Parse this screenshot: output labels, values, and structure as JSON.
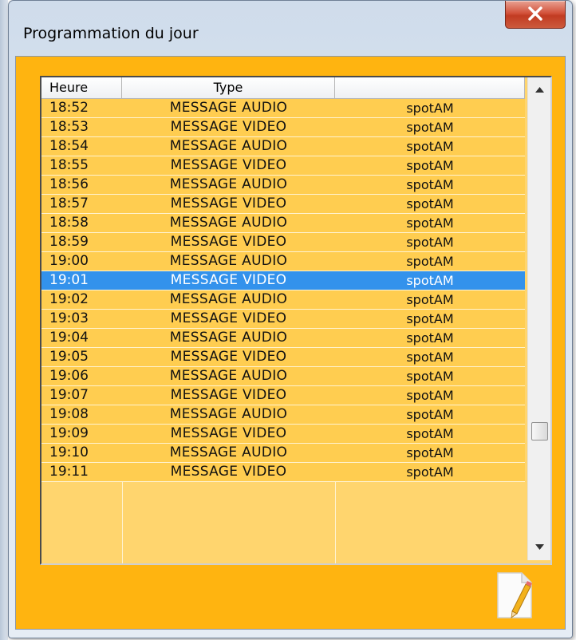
{
  "window": {
    "title": "Programmation du jour"
  },
  "table": {
    "columns": [
      "Heure",
      "Type",
      ""
    ],
    "rows": [
      {
        "heure": "18:52",
        "type": "MESSAGE AUDIO",
        "source": "spotAM"
      },
      {
        "heure": "18:53",
        "type": "MESSAGE VIDEO",
        "source": "spotAM"
      },
      {
        "heure": "18:54",
        "type": "MESSAGE AUDIO",
        "source": "spotAM"
      },
      {
        "heure": "18:55",
        "type": "MESSAGE VIDEO",
        "source": "spotAM"
      },
      {
        "heure": "18:56",
        "type": "MESSAGE AUDIO",
        "source": "spotAM"
      },
      {
        "heure": "18:57",
        "type": "MESSAGE VIDEO",
        "source": "spotAM"
      },
      {
        "heure": "18:58",
        "type": "MESSAGE AUDIO",
        "source": "spotAM"
      },
      {
        "heure": "18:59",
        "type": "MESSAGE VIDEO",
        "source": "spotAM"
      },
      {
        "heure": "19:00",
        "type": "MESSAGE AUDIO",
        "source": "spotAM"
      },
      {
        "heure": "19:01",
        "type": "MESSAGE VIDEO",
        "source": "spotAM",
        "selected": true
      },
      {
        "heure": "19:02",
        "type": "MESSAGE AUDIO",
        "source": "spotAM"
      },
      {
        "heure": "19:03",
        "type": "MESSAGE VIDEO",
        "source": "spotAM"
      },
      {
        "heure": "19:04",
        "type": "MESSAGE AUDIO",
        "source": "spotAM"
      },
      {
        "heure": "19:05",
        "type": "MESSAGE VIDEO",
        "source": "spotAM"
      },
      {
        "heure": "19:06",
        "type": "MESSAGE AUDIO",
        "source": "spotAM"
      },
      {
        "heure": "19:07",
        "type": "MESSAGE VIDEO",
        "source": "spotAM"
      },
      {
        "heure": "19:08",
        "type": "MESSAGE AUDIO",
        "source": "spotAM"
      },
      {
        "heure": "19:09",
        "type": "MESSAGE VIDEO",
        "source": "spotAM"
      },
      {
        "heure": "19:10",
        "type": "MESSAGE AUDIO",
        "source": "spotAM"
      },
      {
        "heure": "19:11",
        "type": "MESSAGE VIDEO",
        "source": "spotAM"
      }
    ]
  },
  "colors": {
    "client_background": "#ffb410",
    "row_background": "#ffcd50",
    "selection": "#3392ec"
  },
  "icons": {
    "close": "close-x-icon",
    "scroll_up": "chevron-up-icon",
    "scroll_down": "chevron-down-icon",
    "edit": "edit-document-icon"
  }
}
